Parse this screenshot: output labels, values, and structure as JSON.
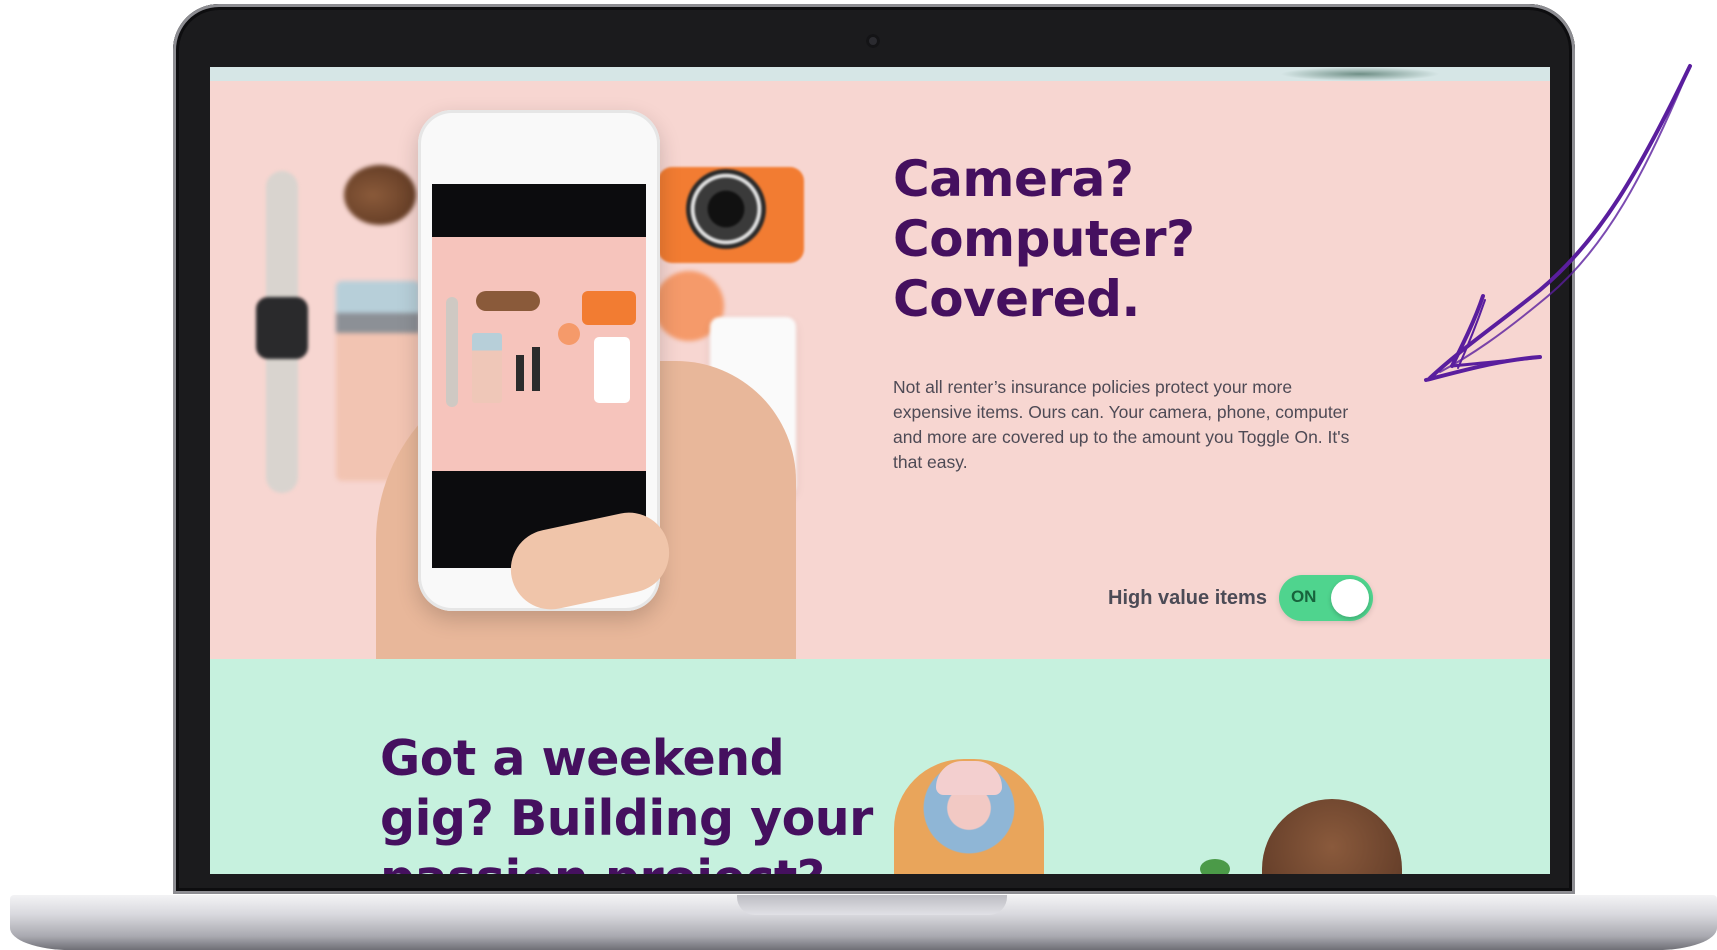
{
  "hero": {
    "title": "Camera?\nComputer?\nCovered.",
    "body": "Not all renter’s insurance policies protect your more expensive items. Ours can. Your camera, phone, computer and more are covered up to the amount you Toggle On. It's that easy.",
    "toggle": {
      "label": "High value items",
      "state_text": "ON",
      "on": true
    }
  },
  "section2": {
    "title": "Got a weekend gig? Building your passion project?"
  },
  "colors": {
    "heading_purple": "#45105f",
    "hero_background": "#f7d6d1",
    "section2_background": "#c6f1de",
    "toggle_green": "#4fd48e",
    "annotation_purple": "#5a1e9e"
  },
  "icons": {
    "annotation": "hand-drawn-arrow-icon"
  }
}
